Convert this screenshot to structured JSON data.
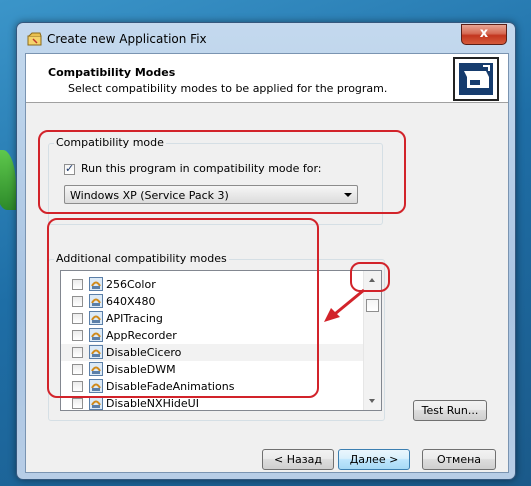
{
  "window": {
    "title": "Create new Application Fix",
    "close_label": "x"
  },
  "header": {
    "title": "Compatibility Modes",
    "subtitle": "Select compatibility modes to be applied for the program."
  },
  "compat_group": {
    "label": "Compatibility mode",
    "checkbox_label": "Run this program in compatibility mode for:",
    "checkbox_checked": true,
    "selected_os": "Windows XP (Service Pack 3)"
  },
  "additional_group": {
    "label": "Additional compatibility modes",
    "items": [
      {
        "label": "256Color",
        "checked": false
      },
      {
        "label": "640X480",
        "checked": false
      },
      {
        "label": "APITracing",
        "checked": false
      },
      {
        "label": "AppRecorder",
        "checked": false
      },
      {
        "label": "DisableCicero",
        "checked": false
      },
      {
        "label": "DisableDWM",
        "checked": false
      },
      {
        "label": "DisableFadeAnimations",
        "checked": false
      },
      {
        "label": "DisableNXHideUI",
        "checked": false
      }
    ]
  },
  "buttons": {
    "test_run": "Test Run...",
    "back": "< Назад",
    "next": "Далее >",
    "cancel": "Отмена"
  },
  "colors": {
    "annotation": "#d2232a",
    "title_bar": "#b9d1ea",
    "close_button": "#c3361f"
  },
  "icons": {
    "title": "application-fix-icon",
    "header": "compatibility-wizard-icon",
    "row": "shim-fix-icon"
  }
}
